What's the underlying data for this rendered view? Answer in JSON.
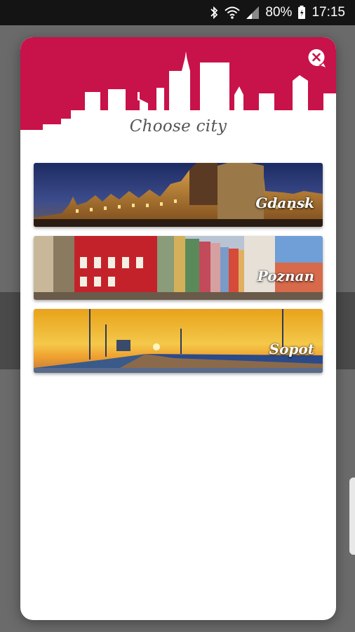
{
  "status_bar": {
    "battery": "80%",
    "time": "17:15",
    "icons": [
      "bluetooth-icon",
      "wifi-icon",
      "signal-icon",
      "battery-icon"
    ]
  },
  "dialog": {
    "title": "Choose city",
    "close_icon": "close-icon",
    "accent_color": "#c8124a",
    "cities": [
      {
        "name": "Gdansk"
      },
      {
        "name": "Poznan"
      },
      {
        "name": "Sopot"
      }
    ]
  }
}
